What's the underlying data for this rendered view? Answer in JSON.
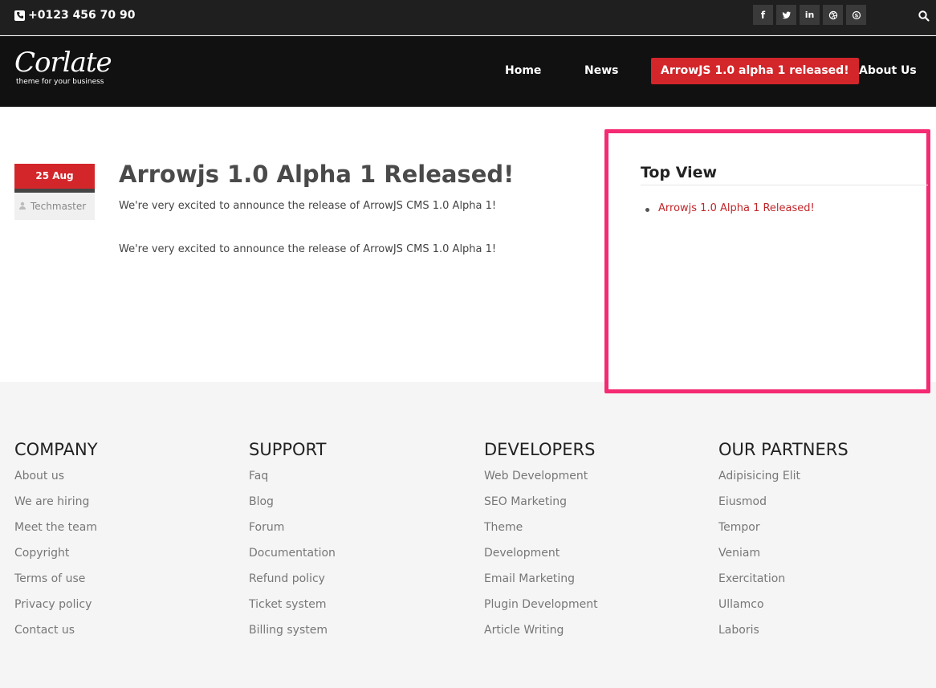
{
  "topbar": {
    "phone": "+0123 456 70 90",
    "socials": [
      {
        "icon": "facebook-icon",
        "glyph": "f"
      },
      {
        "icon": "twitter-icon",
        "glyph": "t"
      },
      {
        "icon": "linkedin-icon",
        "glyph": "in"
      },
      {
        "icon": "dribbble-icon",
        "glyph": "◎"
      },
      {
        "icon": "skype-icon",
        "glyph": "S"
      }
    ]
  },
  "brand": {
    "name": "Corlate",
    "tagline": "theme for your business"
  },
  "nav": {
    "items": [
      {
        "label": "Home"
      },
      {
        "label": "News"
      },
      {
        "label": "ArrowJS 1.0 alpha 1 released!"
      },
      {
        "label": "About Us"
      }
    ],
    "active_color": "#d3262a"
  },
  "post": {
    "date": "25 Aug",
    "author": "Techmaster",
    "title": "Arrowjs 1.0 Alpha 1 Released!",
    "excerpt": "We're very excited to announce the release of ArrowJS CMS 1.0 Alpha 1!",
    "body": "We're very excited to announce the release of ArrowJS CMS 1.0 Alpha 1!"
  },
  "sidebar": {
    "title": "Top View",
    "items": [
      "Arrowjs 1.0 Alpha 1 Released!"
    ],
    "highlight_color": "#f42a72"
  },
  "footer": {
    "columns": [
      {
        "title": "COMPANY",
        "links": [
          "About us",
          "We are hiring",
          "Meet the team",
          "Copyright",
          "Terms of use",
          "Privacy policy",
          "Contact us"
        ]
      },
      {
        "title": "SUPPORT",
        "links": [
          "Faq",
          "Blog",
          "Forum",
          "Documentation",
          "Refund policy",
          "Ticket system",
          "Billing system"
        ]
      },
      {
        "title": "DEVELOPERS",
        "links": [
          "Web Development",
          "SEO Marketing",
          "Theme",
          "Development",
          "Email Marketing",
          "Plugin Development",
          "Article Writing"
        ]
      },
      {
        "title": "OUR PARTNERS",
        "links": [
          "Adipisicing Elit",
          "Eiusmod",
          "Tempor",
          "Veniam",
          "Exercitation",
          "Ullamco",
          "Laboris"
        ]
      }
    ]
  }
}
